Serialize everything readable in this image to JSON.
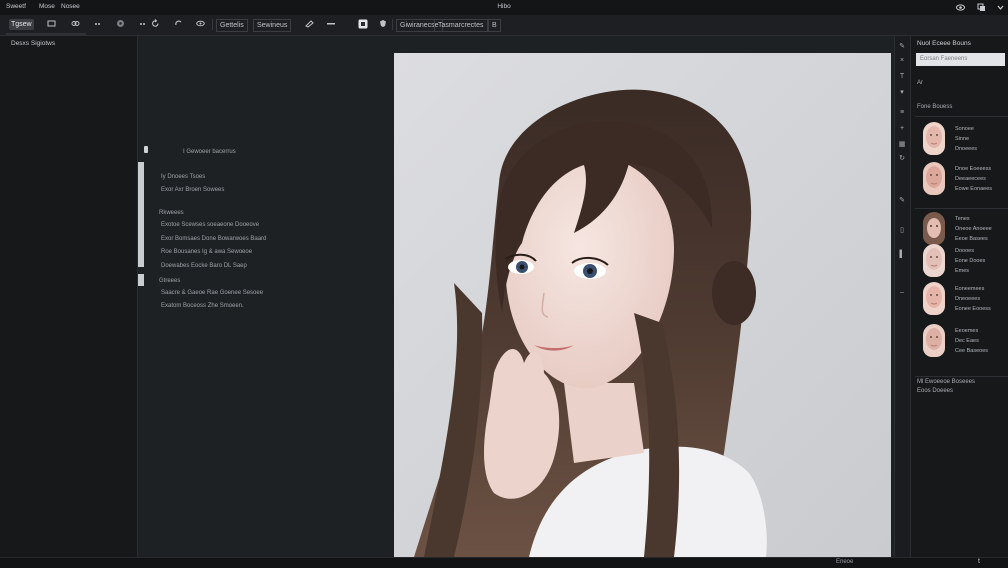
{
  "menu": {
    "items": [
      "Sweetf",
      "Mose",
      "Nosee"
    ],
    "window_title": "Hibo",
    "right_icons": [
      "eye-icon",
      "copy-icon",
      "chevron-down-icon"
    ]
  },
  "toolbar": {
    "items": [
      {
        "label": "Tgsew",
        "icon": "tool-icon",
        "active": true
      },
      {
        "label": "",
        "icon": "rectangle-icon"
      },
      {
        "label": "",
        "icon": "link-icon"
      },
      {
        "label": "",
        "icon": "dots-icon"
      },
      {
        "label": "",
        "icon": "disc-icon"
      },
      {
        "label": "",
        "icon": "refresh-icon"
      },
      {
        "label": "",
        "icon": "undo-icon"
      },
      {
        "label": "",
        "icon": "eye-icon"
      },
      {
        "label": "Gettelis",
        "icon": "box-icon"
      },
      {
        "label": "Sewineus",
        "icon": ""
      },
      {
        "label": "",
        "icon": "brush-icon"
      },
      {
        "label": "",
        "icon": "dots-icon"
      },
      {
        "label": "",
        "icon": "square-icon"
      },
      {
        "label": "",
        "icon": "shield-icon"
      },
      {
        "label": "Giwiranecse",
        "icon": ""
      },
      {
        "label": "Tasmarcrectes",
        "icon": ""
      },
      {
        "label": "B",
        "icon": ""
      }
    ]
  },
  "left_panel": {
    "title": "Desxs Sigiotws"
  },
  "inspector": {
    "lines": [
      "I    Gewoeer bacerrus",
      "Iy         Dnoees Tsoes",
      "Exor   Axr  Broen  Sowees",
      "Rkweees",
      "Exotoe   Scewses  soeaeone Dooeove",
      "Exor  Bomsaes  Done  Bowarwoes  Baard",
      "Roe Bousanes  Ig  & awa  Sewoeoe",
      "Doewabes Eocke Baro   DL Saep",
      "Gtreees",
      "Saacre  &  Gaeoe  Rae  Goenee  Sesoee",
      "Exatom  Boceoss  Zhe  Smoeen."
    ]
  },
  "vertical_toolbar": {
    "icons": [
      "brush-icon",
      "close-icon",
      "text-icon",
      "pointer-icon",
      "sliders-icon",
      "plus-icon",
      "grid-icon",
      "refresh-icon",
      "brush-icon",
      "copy-icon",
      "minus-icon",
      "bar-icon"
    ]
  },
  "right_panel": {
    "title": "Nuol  Eceee Bouns",
    "search_placeholder": "Eorsan Faeneens",
    "header_lines": [
      "Ar",
      "Fone   Bouess"
    ],
    "faces": [
      {
        "labels": [
          "Sonoee",
          "Sinne",
          "Dnoeees"
        ]
      },
      {
        "labels": [
          "Dnoe Eoeeess",
          "Deeaeecees",
          "Eowe Eonaees"
        ]
      },
      {
        "labels": [
          "Tenes",
          "Oneoe Anoeee",
          "Eeoe  Basees"
        ]
      },
      {
        "labels": [
          "Doooes",
          "Eone Dooes",
          "Emes"
        ]
      },
      {
        "labels": [
          "Eoneemees",
          "Dneoeees",
          "Eonee Eooess"
        ]
      },
      {
        "labels": [
          "Eeoemes",
          "Dec Eaes",
          "Cee Baseoes"
        ]
      }
    ],
    "footer_lines": [
      "Ml  Ewoeeoe  Boseees",
      "Eoos  Doeees"
    ]
  },
  "status": {
    "text": "Eneoe",
    "mark": "t"
  }
}
